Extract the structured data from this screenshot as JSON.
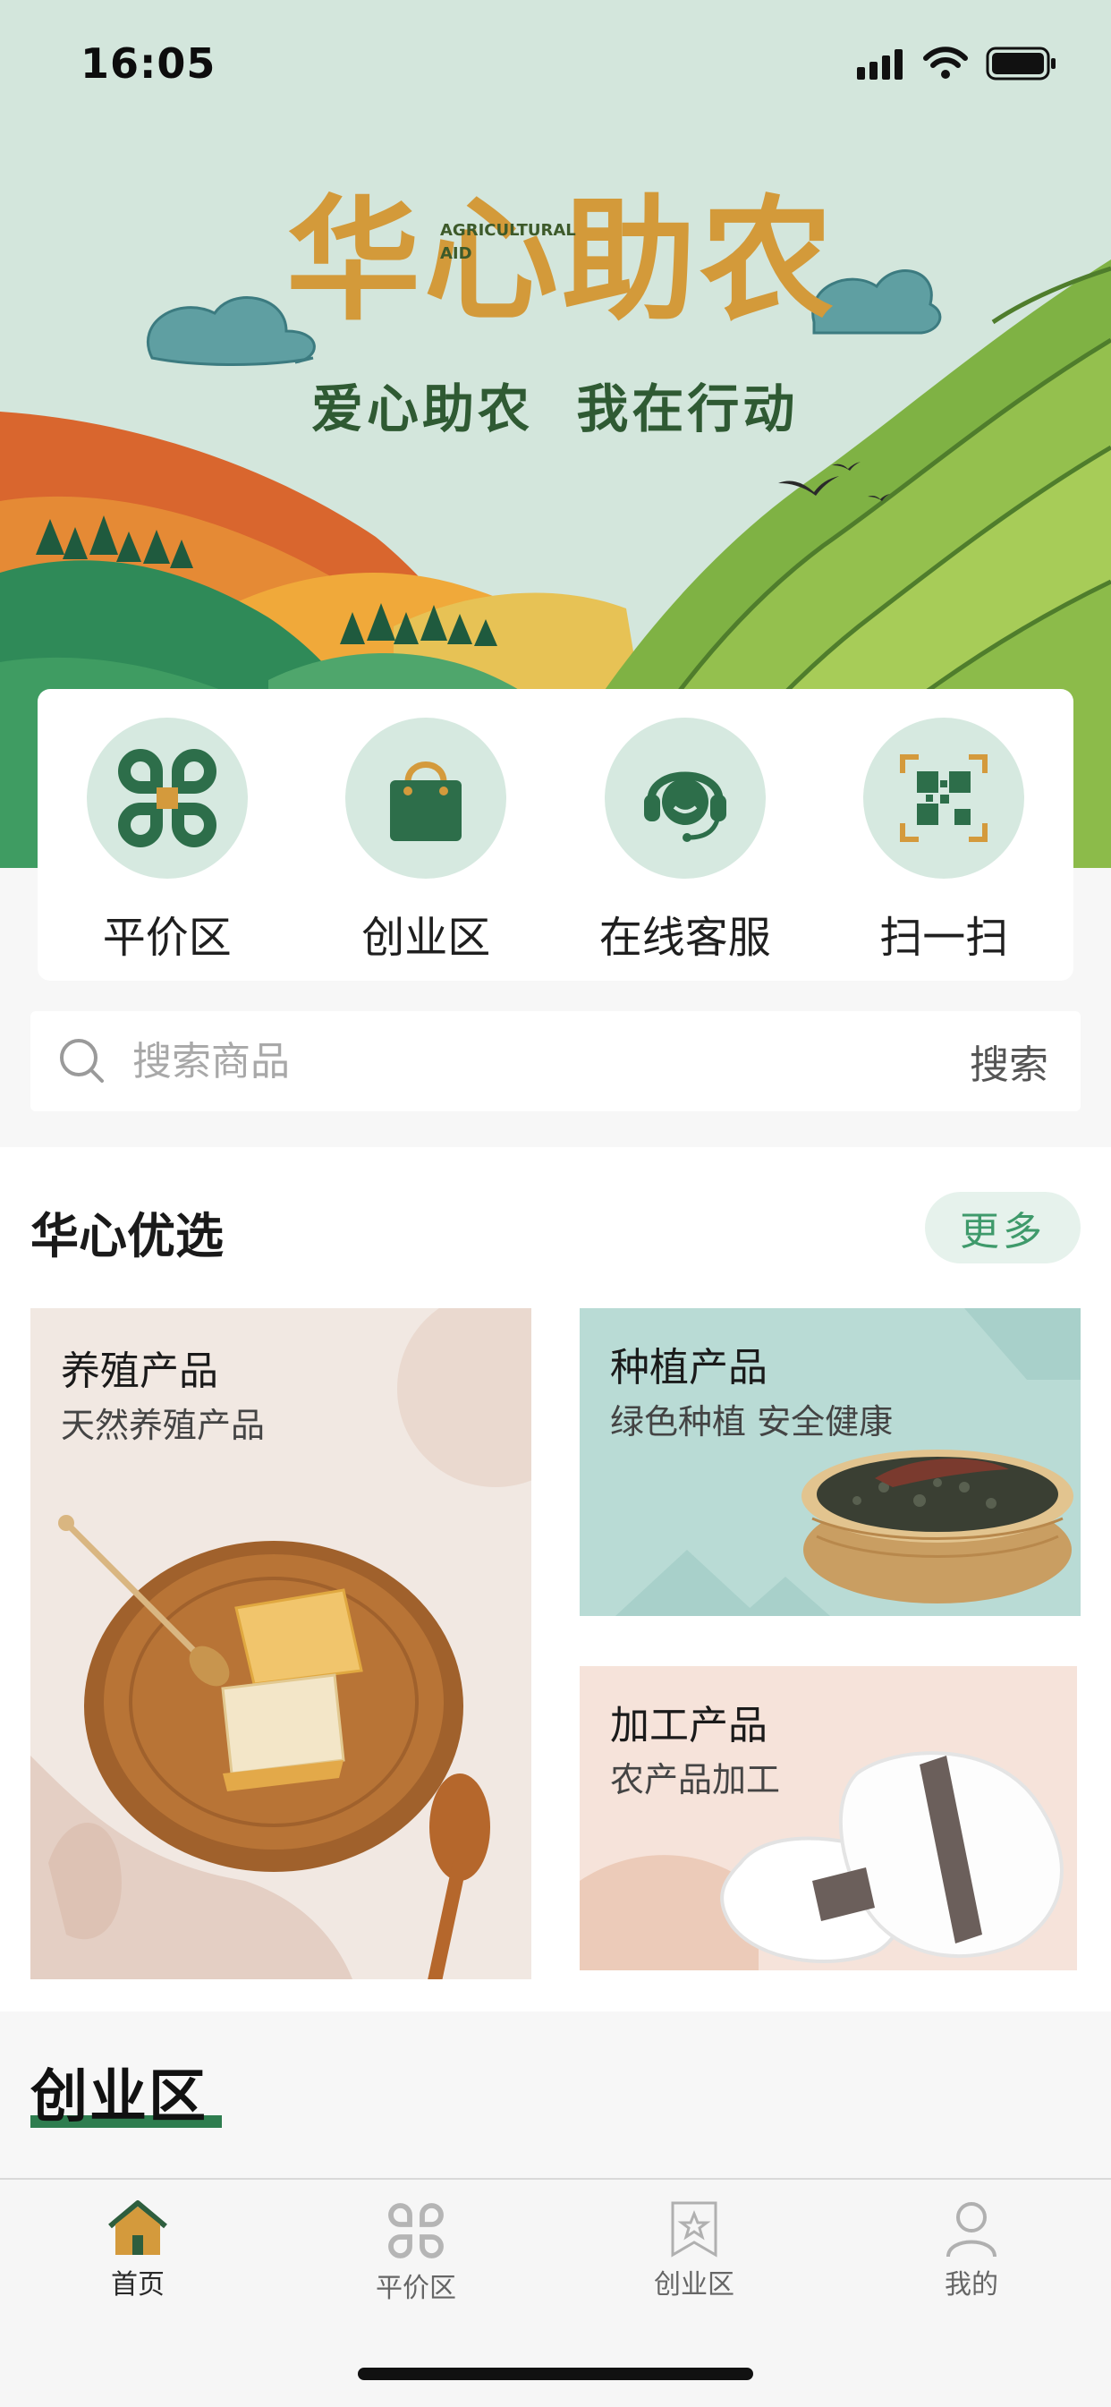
{
  "status_bar": {
    "time": "16:05"
  },
  "banner": {
    "title": "华心助农",
    "english_line1": "AGRICULTURAL",
    "english_line2": "AID",
    "slogan": "爱心助农  我在行动"
  },
  "quick_nav": [
    {
      "label": "平价区",
      "icon": "grid-clover-icon"
    },
    {
      "label": "创业区",
      "icon": "shopping-bag-icon"
    },
    {
      "label": "在线客服",
      "icon": "customer-service-icon"
    },
    {
      "label": "扫一扫",
      "icon": "qr-scan-icon"
    }
  ],
  "search": {
    "placeholder": "搜索商品",
    "button_label": "搜索"
  },
  "featured": {
    "title": "华心优选",
    "more_label": "更多",
    "products": [
      {
        "name": "养殖产品",
        "desc": "天然养殖产品"
      },
      {
        "name": "种植产品",
        "desc": "绿色种植 安全健康"
      },
      {
        "name": "加工产品",
        "desc": "农产品加工"
      }
    ]
  },
  "entrepreneur": {
    "title": "创业区"
  },
  "tab_bar": [
    {
      "label": "首页",
      "icon": "home-icon",
      "active": true
    },
    {
      "label": "平价区",
      "icon": "grid-clover-icon",
      "active": false
    },
    {
      "label": "创业区",
      "icon": "star-bookmark-icon",
      "active": false
    },
    {
      "label": "我的",
      "icon": "user-icon",
      "active": false
    }
  ],
  "colors": {
    "accent_green": "#2e7d4f",
    "more_text": "#3f9a6b",
    "icon_circle": "#d6e9e0",
    "brand_gold": "#d39a3a"
  }
}
